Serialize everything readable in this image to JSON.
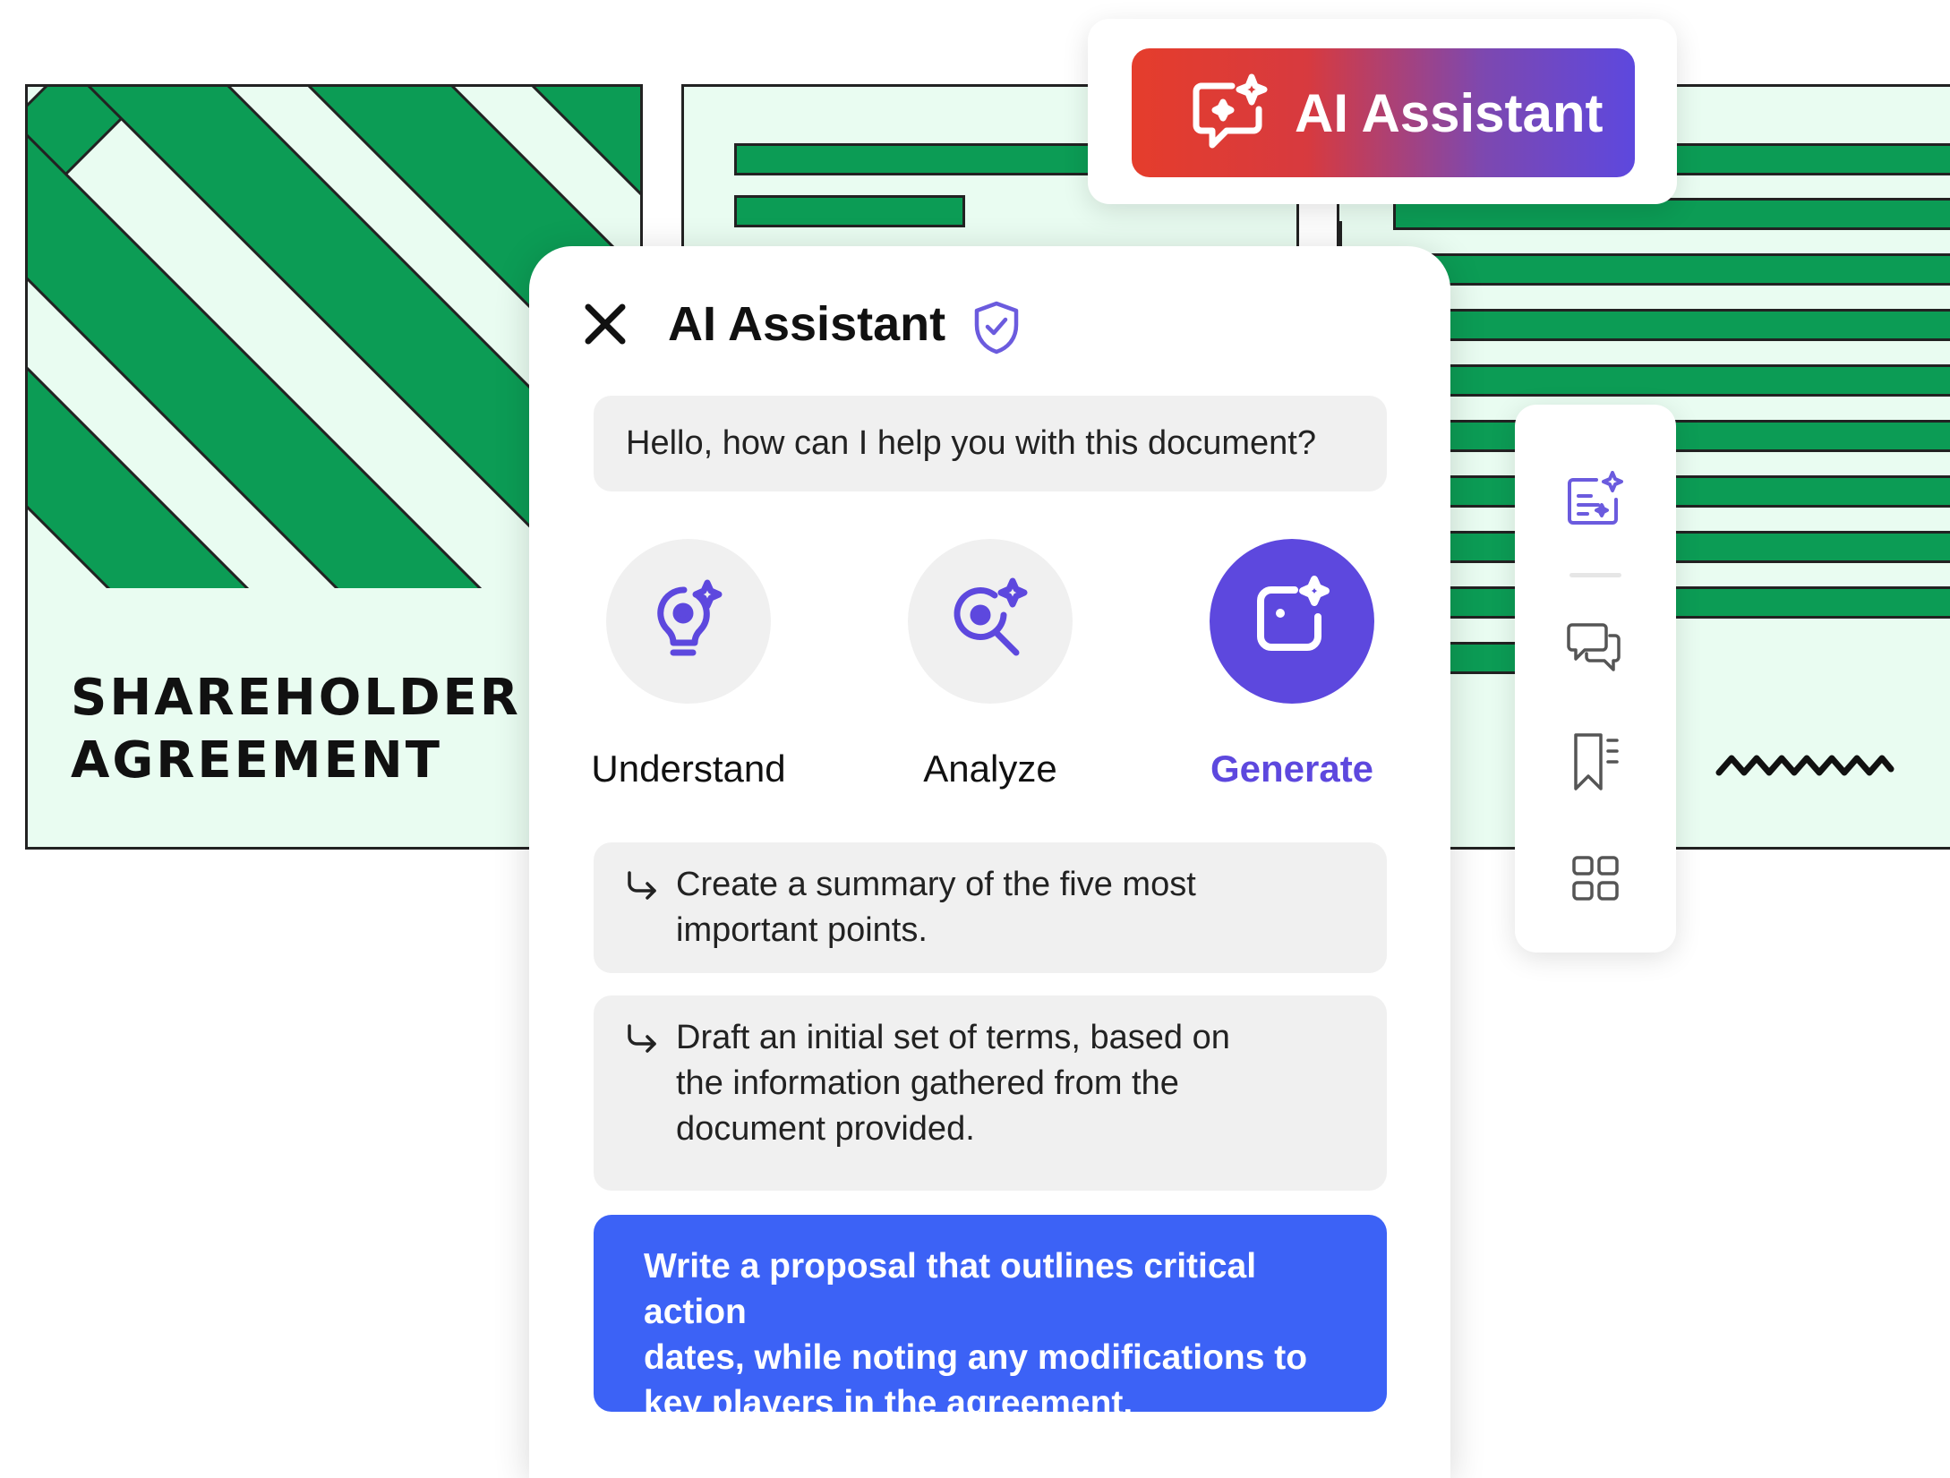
{
  "document": {
    "cover_title_line1": "SHAREHOLDER",
    "cover_title_line2": "AGREEMENT",
    "accent_color": "#0c9c55",
    "background_color": "#e9fcf1"
  },
  "badge": {
    "label": "AI Assistant",
    "icon": "ai-chat-sparkle-icon"
  },
  "panel": {
    "title": "AI Assistant",
    "close_icon": "close-icon",
    "shield_icon": "shield-check-icon",
    "greeting": "Hello, how can I help you with this document?",
    "modes": [
      {
        "label": "Understand",
        "icon": "lightbulb-sparkle-icon",
        "selected": false
      },
      {
        "label": "Analyze",
        "icon": "magnifier-sparkle-icon",
        "selected": false
      },
      {
        "label": "Generate",
        "icon": "generate-sparkle-icon",
        "selected": true
      }
    ],
    "suggestions": [
      {
        "text_line1": "Create a summary of the five most",
        "text_line2": "important points."
      },
      {
        "text_line1": "Draft an initial set of terms, based on",
        "text_line2": "the information gathered from the",
        "text_line3": "document provided."
      }
    ],
    "highlight_prompt": {
      "line1": "Write a proposal that outlines critical action",
      "line2": "dates, while noting any modifications to",
      "line3": "key players in the agreement."
    },
    "accent_color": "#5d48de",
    "prompt_color": "#3c62f6"
  },
  "toolbar": {
    "tools": [
      "ai-edit-icon",
      "comments-icon",
      "bookmark-icon",
      "grid-icon"
    ]
  }
}
